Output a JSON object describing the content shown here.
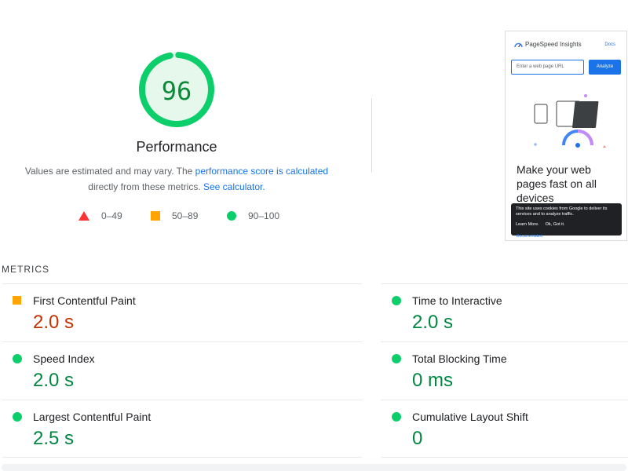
{
  "performance": {
    "score": "96",
    "score_fraction": 0.96,
    "title": "Performance",
    "desc_prefix": "Values are estimated and may vary. The ",
    "desc_link1": "performance score is calculated",
    "desc_middle": " directly from these metrics.",
    "desc_link2": "See calculator.",
    "gauge_color": "#0cce6b",
    "gauge_bg_color": "#e6f7ec"
  },
  "legend": [
    {
      "range": "0–49",
      "shape": "triangle",
      "color": "#ff3333"
    },
    {
      "range": "50–89",
      "shape": "square",
      "color": "#ffa400"
    },
    {
      "range": "90–100",
      "shape": "circle",
      "color": "#0cce6b"
    }
  ],
  "screenshot": {
    "brand": "PageSpeed Insights",
    "docs": "Docs",
    "input_placeholder": "Enter a web page URL",
    "button": "Analyze",
    "headline": "Make your web pages fast on all devices",
    "cookie_text": "This site uses cookies from Google to deliver its services and to analyze traffic.",
    "cookie_learn": "Learn More.",
    "cookie_ok": "Ok, Got it.",
    "footer": "Documentation"
  },
  "metrics": {
    "header": "METRICS",
    "items": [
      {
        "label": "First Contentful Paint",
        "value": "2.0 s",
        "status": "average"
      },
      {
        "label": "Time to Interactive",
        "value": "2.0 s",
        "status": "pass"
      },
      {
        "label": "Speed Index",
        "value": "2.0 s",
        "status": "pass"
      },
      {
        "label": "Total Blocking Time",
        "value": "0 ms",
        "status": "pass"
      },
      {
        "label": "Largest Contentful Paint",
        "value": "2.5 s",
        "status": "pass"
      },
      {
        "label": "Cumulative Layout Shift",
        "value": "0",
        "status": "pass"
      }
    ]
  }
}
